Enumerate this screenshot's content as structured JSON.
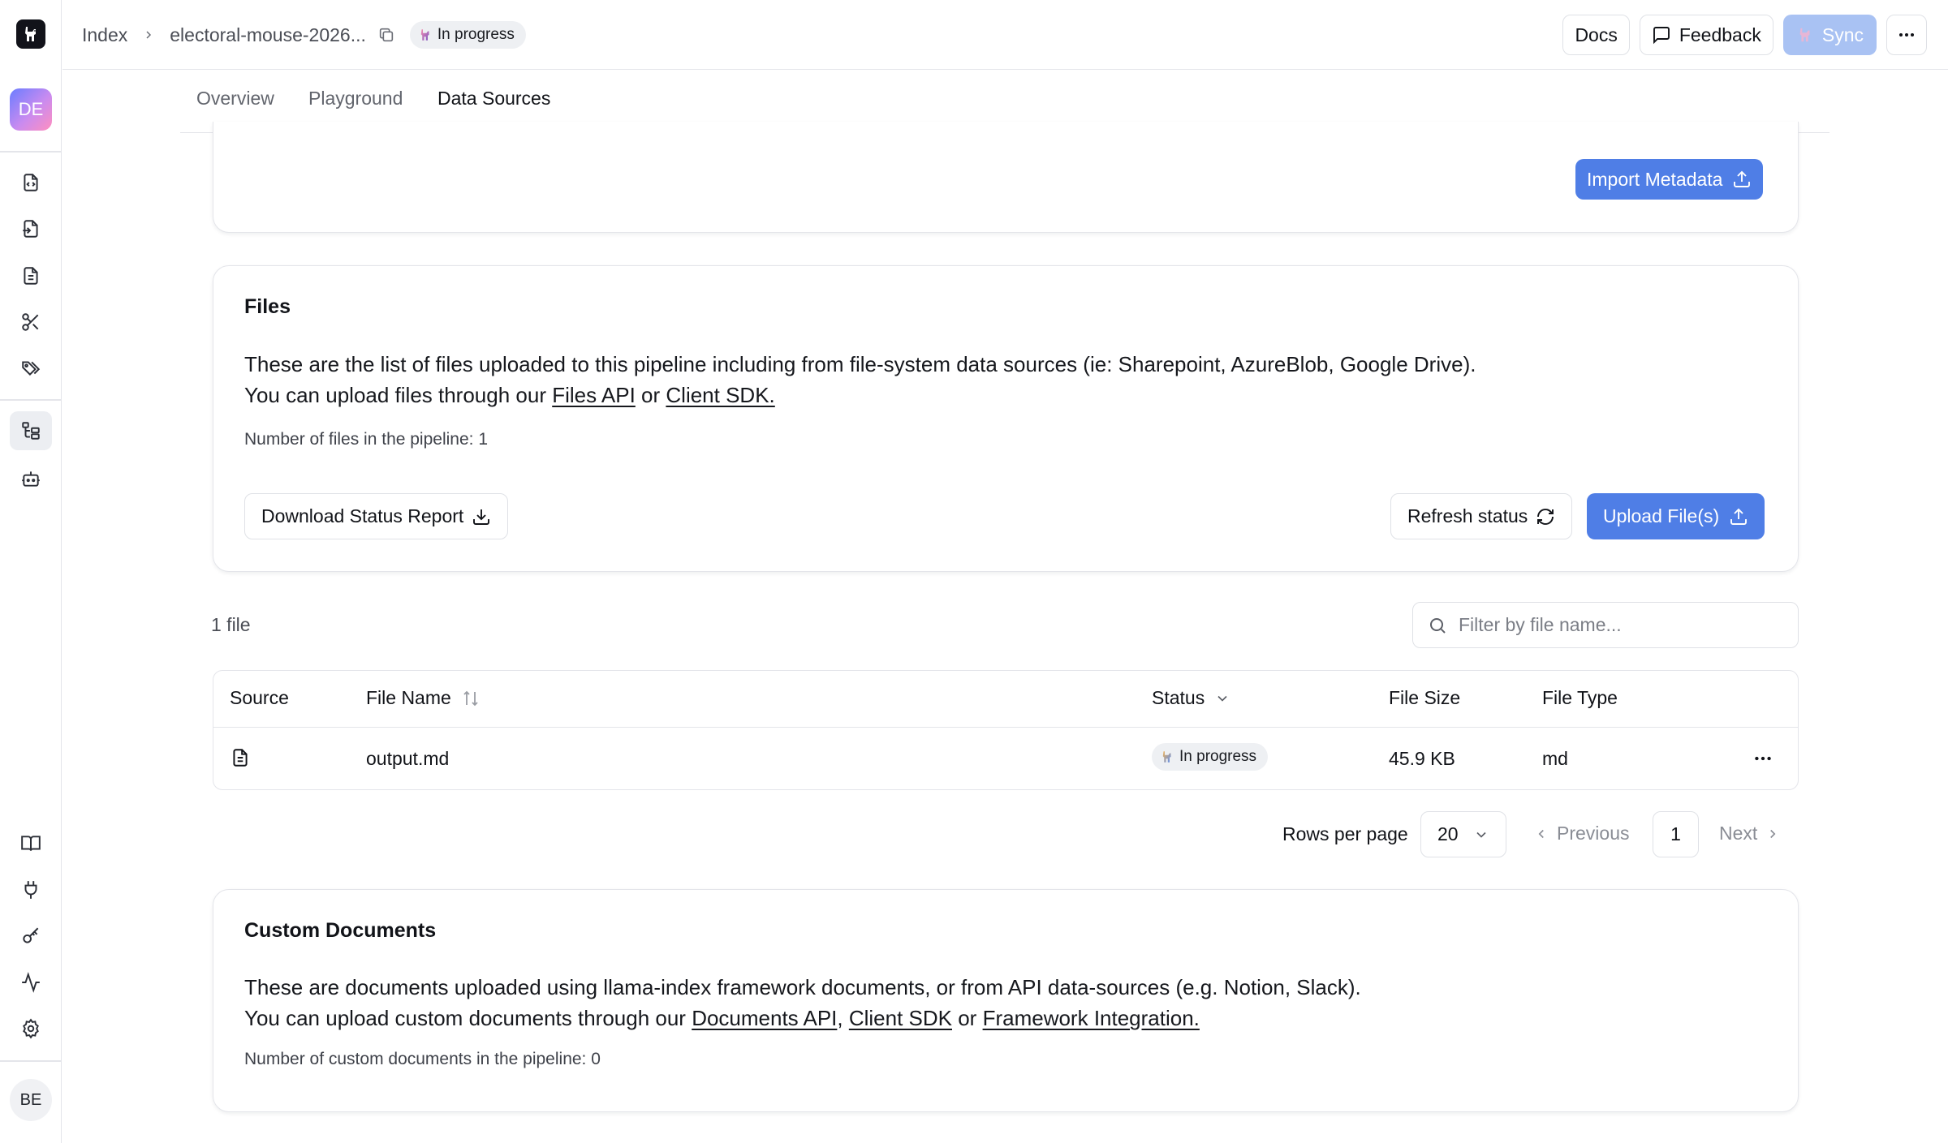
{
  "rail": {
    "avatar_initials": "DE",
    "user_initials": "BE"
  },
  "breadcrumb": {
    "root": "Index",
    "current": "electoral-mouse-2026...",
    "status": "In progress"
  },
  "header_actions": {
    "docs": "Docs",
    "feedback": "Feedback",
    "sync": "Sync"
  },
  "tabs": [
    "Overview",
    "Playground",
    "Data Sources"
  ],
  "metadata_card": {
    "import_button": "Import Metadata"
  },
  "files_card": {
    "title": "Files",
    "line1": "These are the list of files uploaded to this pipeline including from file-system data sources (ie: Sharepoint, AzureBlob, Google Drive).",
    "line2_prefix": "You can upload files through our ",
    "files_api_link": "Files API",
    "line2_or": " or ",
    "client_sdk_link": "Client SDK.",
    "count_note": "Number of files in the pipeline: 1",
    "download_button": "Download Status Report",
    "refresh_button": "Refresh status",
    "upload_button": "Upload File(s)"
  },
  "files_table": {
    "count_label": "1 file",
    "filter_placeholder": "Filter by file name...",
    "columns": [
      "Source",
      "File Name",
      "Status",
      "File Size",
      "File Type"
    ],
    "rows": [
      {
        "name": "output.md",
        "status": "In progress",
        "size": "45.9 KB",
        "type": "md"
      }
    ]
  },
  "pagination": {
    "rows_per_page_label": "Rows per page",
    "rows_per_page": "20",
    "previous": "Previous",
    "current_page": "1",
    "next": "Next"
  },
  "custom_card": {
    "title": "Custom Documents",
    "line1": "These are documents uploaded using llama-index framework documents, or from API data-sources (e.g. Notion, Slack).",
    "line2_prefix": "You can upload custom documents through our ",
    "documents_api_link": "Documents API",
    "comma": ", ",
    "client_sdk_link": "Client SDK",
    "line2_or": " or ",
    "framework_link": "Framework Integration.",
    "count_note": "Number of custom documents in the pipeline: 0"
  },
  "colors": {
    "primary": "#4f7ee6",
    "primary_disabled": "#a9c2f3",
    "border": "#e4e5ea",
    "status_pill_bg": "#eef0f3"
  }
}
